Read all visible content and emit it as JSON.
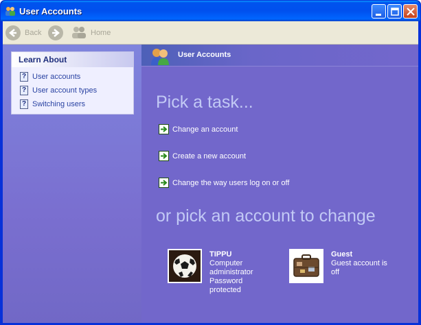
{
  "window": {
    "title": "User Accounts"
  },
  "toolbar": {
    "back_label": "Back",
    "home_label": "Home"
  },
  "sidebar": {
    "heading": "Learn About",
    "items": [
      {
        "label": "User accounts",
        "icon": "help-icon"
      },
      {
        "label": "User account types",
        "icon": "help-icon"
      },
      {
        "label": "Switching users",
        "icon": "help-icon"
      }
    ]
  },
  "main": {
    "header_title": "User Accounts",
    "pick_task": "Pick a task...",
    "tasks": [
      {
        "label": "Change an account",
        "icon": "green-arrow-icon"
      },
      {
        "label": "Create a new account",
        "icon": "green-arrow-icon"
      },
      {
        "label": "Change the way users log on or off",
        "icon": "green-arrow-icon"
      }
    ],
    "or_pick": "or pick an account to change",
    "accounts": [
      {
        "name": "TIPPU",
        "desc_lines": [
          "Computer",
          "administrator",
          "Password",
          "protected"
        ],
        "picture": "soccer-ball"
      },
      {
        "name": "Guest",
        "desc_lines": [
          "Guest account is",
          "off"
        ],
        "picture": "suitcase"
      }
    ]
  },
  "colors": {
    "titlebar": "#0053ee",
    "content_bg": "#7267cb",
    "heading_text": "#c2c9f5"
  }
}
